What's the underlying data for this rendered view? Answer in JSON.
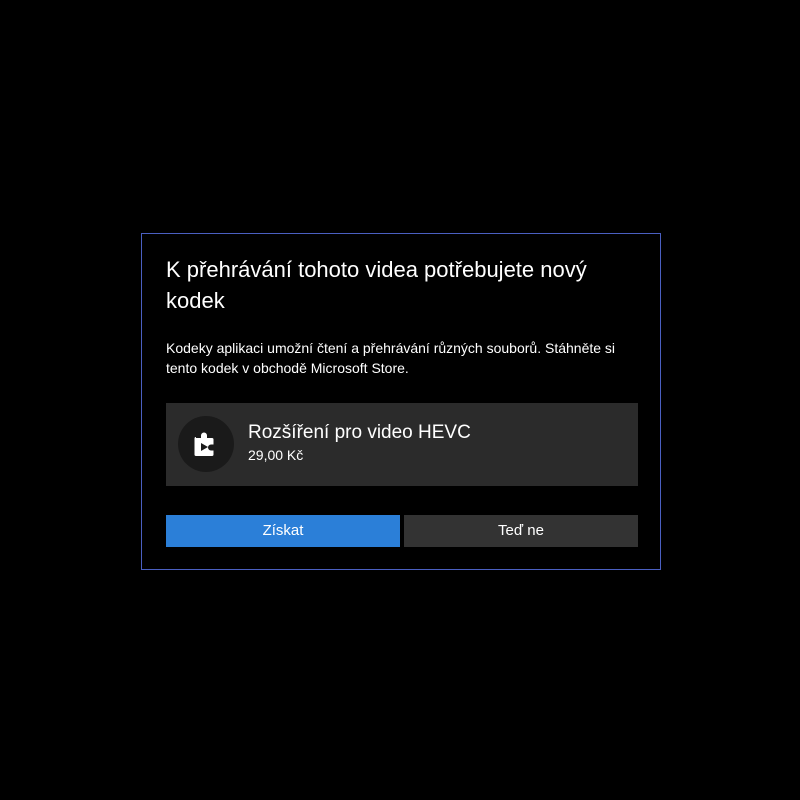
{
  "dialog": {
    "title": "K přehrávání tohoto videa potřebujete nový kodek",
    "description": "Kodeky aplikaci umožní čtení a přehrávání různých souborů. Stáhněte si tento kodek v obchodě Microsoft Store.",
    "product": {
      "icon": "puzzle-play-icon",
      "name": "Rozšíření pro video HEVC",
      "price": "29,00 Kč"
    },
    "buttons": {
      "primary_label": "Získat",
      "secondary_label": "Teď ne"
    }
  },
  "colors": {
    "background": "#000000",
    "dialog_border": "#4a5fc1",
    "card_background": "#2b2b2b",
    "primary_button": "#2b7fd8",
    "secondary_button": "#333333",
    "text": "#ffffff"
  }
}
